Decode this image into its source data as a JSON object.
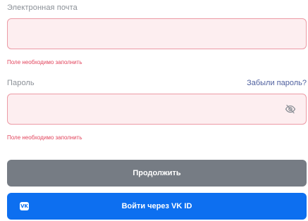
{
  "email": {
    "label": "Электронная почта",
    "value": "",
    "placeholder": "",
    "error": "Поле необходимо заполнить"
  },
  "password": {
    "label": "Пароль",
    "forgot_link": "Забыли пароль?",
    "value": "",
    "placeholder": "",
    "error": "Поле необходимо заполнить",
    "visibility_icon": "eye-off-icon"
  },
  "buttons": {
    "continue_label": "Продолжить",
    "vk_label": "Войти через VK ID",
    "vk_logo_text": "VK"
  },
  "colors": {
    "error": "#e2445c",
    "field_background": "#fdeef0",
    "field_border": "#ec9aa5",
    "continue_button": "#767c84",
    "vk_button": "#0d6ff0",
    "link": "#4e5f9e"
  }
}
